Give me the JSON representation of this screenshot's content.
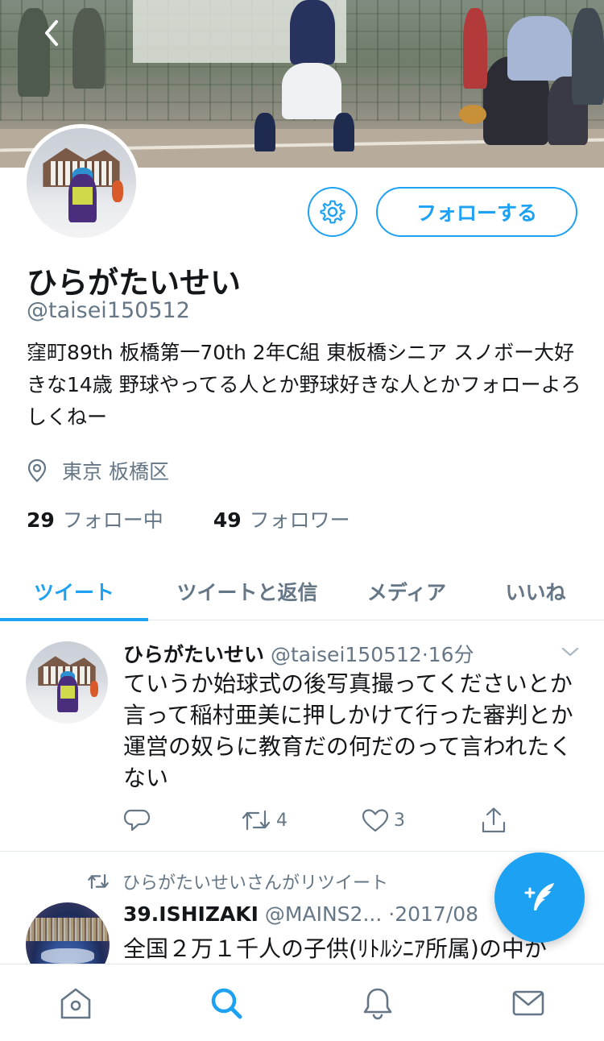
{
  "profile": {
    "name": "ひらがたいせい",
    "handle": "@taisei150512",
    "bio": "窪町89th 板橋第一70th 2年C組 東板橋シニア スノボー大好きな14歳 野球やってる人とか野球好きな人とかフォローよろしくねー",
    "location": "東京 板橋区",
    "following_count": "29",
    "following_label": "フォロー中",
    "followers_count": "49",
    "followers_label": "フォロワー",
    "follow_button": "フォローする"
  },
  "tabs": [
    {
      "label": "ツイート",
      "active": true
    },
    {
      "label": "ツイートと返信",
      "active": false
    },
    {
      "label": "メディア",
      "active": false
    },
    {
      "label": "いいね",
      "active": false
    }
  ],
  "tweets": [
    {
      "name": "ひらがたいせい",
      "handle": "@taisei150512",
      "sep": "·",
      "time": "16分",
      "text": "ていうか始球式の後写真撮ってくださいとか言って稲村亜美に押しかけて行った審判とか運営の奴らに教育だの何だのって言われたくない",
      "retweets": "4",
      "likes": "3"
    },
    {
      "retweet_note": "ひらがたいせいさんがリツイート",
      "name": "39.ISHIZAKI",
      "handle": "@MAINS2...",
      "sep": "·",
      "time": "2017/08",
      "text": "全国２万１千人の子供(ﾘﾄﾙｼﾆｱ所属)の中か"
    }
  ],
  "colors": {
    "accent": "#1da1f2",
    "secondary_text": "#657786",
    "primary_text": "#14171a"
  },
  "icons": {
    "back": "back-chevron-icon",
    "settings": "gear-icon",
    "location": "location-pin-icon",
    "reply": "reply-icon",
    "retweet": "retweet-icon",
    "like": "heart-icon",
    "share": "share-icon",
    "compose": "compose-icon",
    "home": "home-icon",
    "search": "search-icon",
    "notifications": "bell-icon",
    "messages": "mail-icon"
  }
}
